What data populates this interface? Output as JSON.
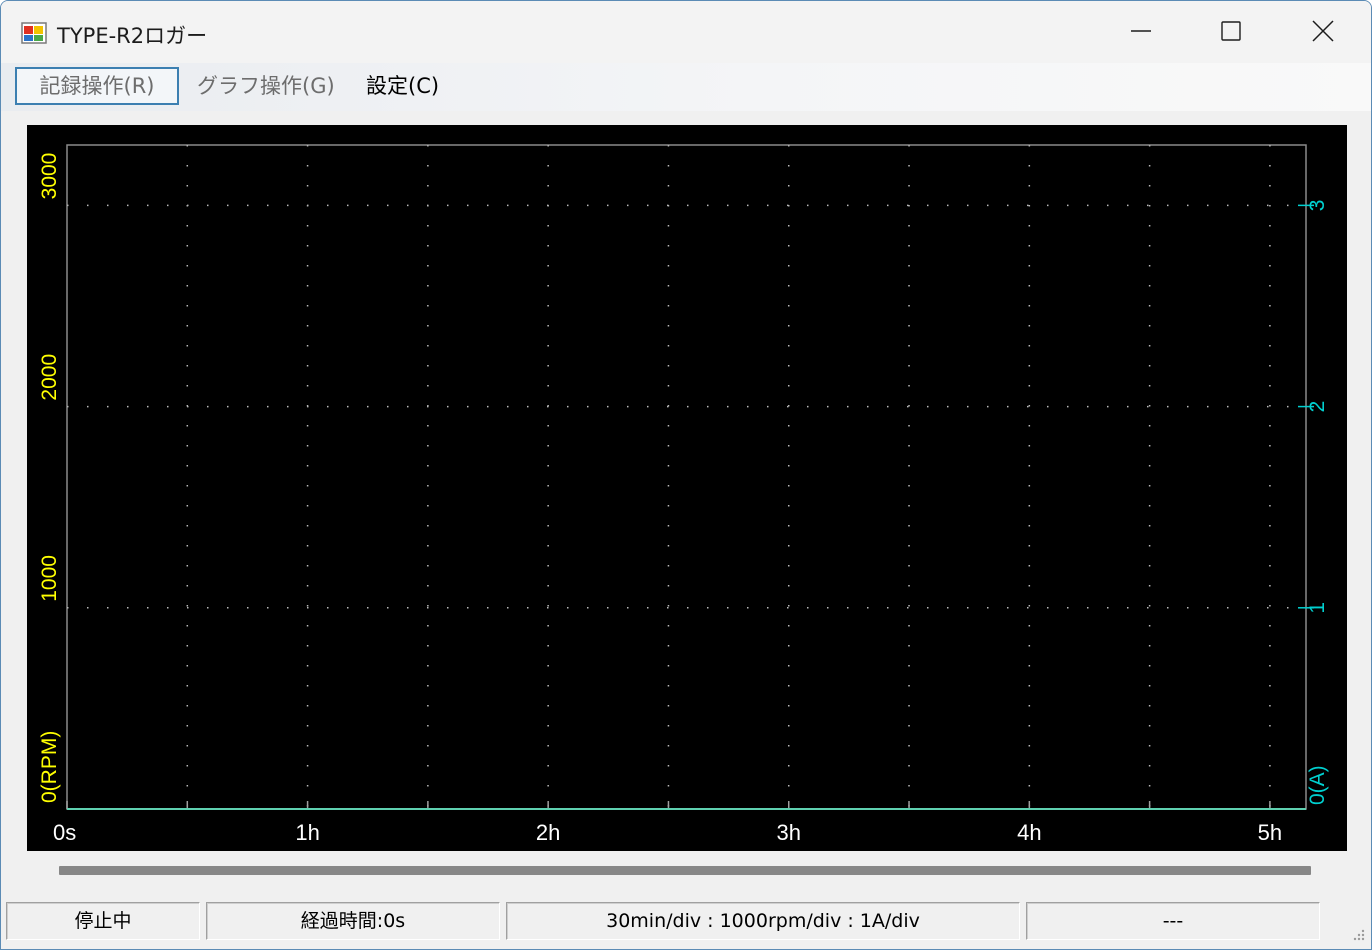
{
  "window": {
    "title": "TYPE-R2ロガー",
    "controls": [
      "minimize-icon",
      "maximize-icon",
      "close-icon"
    ]
  },
  "menu": {
    "items": [
      {
        "label": "記録操作(R)",
        "state": "disabled-focused"
      },
      {
        "label": "グラフ操作(G)",
        "state": "disabled"
      },
      {
        "label": "設定(C)",
        "state": "enabled"
      }
    ]
  },
  "chart_data": {
    "type": "line",
    "x_ticks": [
      "0s",
      "1h",
      "2h",
      "3h",
      "4h",
      "5h"
    ],
    "xlim_hours": [
      0,
      5.15
    ],
    "left_axis": {
      "ticks": [
        "0(RPM)",
        "1000",
        "2000",
        "3000"
      ],
      "ylim": [
        0,
        3300
      ],
      "color": "#ffff00"
    },
    "right_axis": {
      "ticks": [
        "0(A)",
        "1",
        "2",
        "3"
      ],
      "ylim": [
        0,
        3.3
      ],
      "color": "#00d0d0"
    },
    "grid": "dotted",
    "series": [
      {
        "values": [
          0
        ],
        "color": "#5fd0b0"
      }
    ]
  },
  "status": {
    "state": "停止中",
    "elapsed": "経過時間:0s",
    "scale": "30min/div : 1000rpm/div : 1A/div",
    "extra": "---"
  }
}
